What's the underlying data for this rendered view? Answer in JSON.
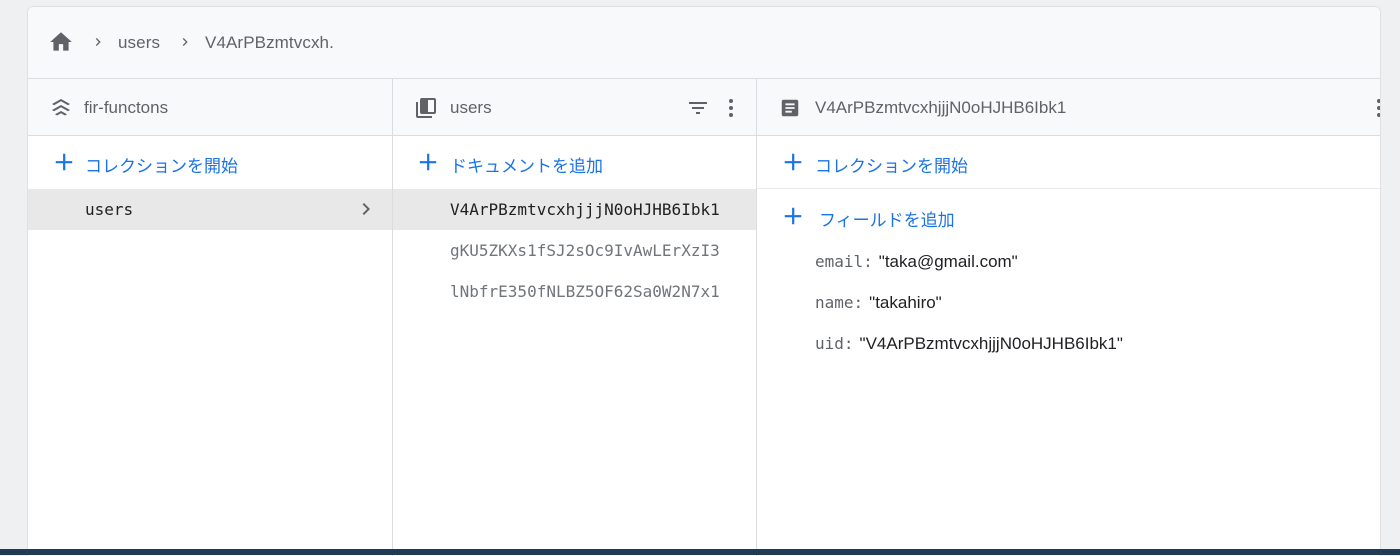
{
  "breadcrumb": {
    "home_icon": "home-icon",
    "items": [
      "users",
      "V4ArPBzmtvcxh."
    ]
  },
  "columns": {
    "project": {
      "title": "fir-functons",
      "icon": "firestore-stack-icon",
      "add_label": "コレクションを開始",
      "items": [
        {
          "label": "users",
          "selected": true
        }
      ]
    },
    "collection": {
      "title": "users",
      "icon": "collection-icon",
      "add_label": "ドキュメントを追加",
      "documents": [
        {
          "id": "V4ArPBzmtvcxhjjjN0oHJHB6Ibk1",
          "selected": true
        },
        {
          "id": "gKU5ZKXs1fSJ2sOc9IvAwLErXzI3",
          "selected": false
        },
        {
          "id": "lNbfrE350fNLBZ5OF62Sa0W2N7x1",
          "selected": false
        }
      ]
    },
    "document": {
      "title": "V4ArPBzmtvcxhjjjN0oHJHB6Ibk1",
      "icon": "document-icon",
      "add_collection_label": "コレクションを開始",
      "add_field_label": "フィールドを追加",
      "fields": [
        {
          "key": "email:",
          "value": "\"taka@gmail.com\""
        },
        {
          "key": "name:",
          "value": "\"takahiro\""
        },
        {
          "key": "uid:",
          "value": "\"V4ArPBzmtvcxhjjjN0oHJHB6Ibk1\""
        }
      ]
    }
  },
  "colors": {
    "accent": "#1a73e8",
    "selected_row": "#e8e8e8",
    "header_bg": "#f8f9fa",
    "muted_text": "#5f6368"
  }
}
